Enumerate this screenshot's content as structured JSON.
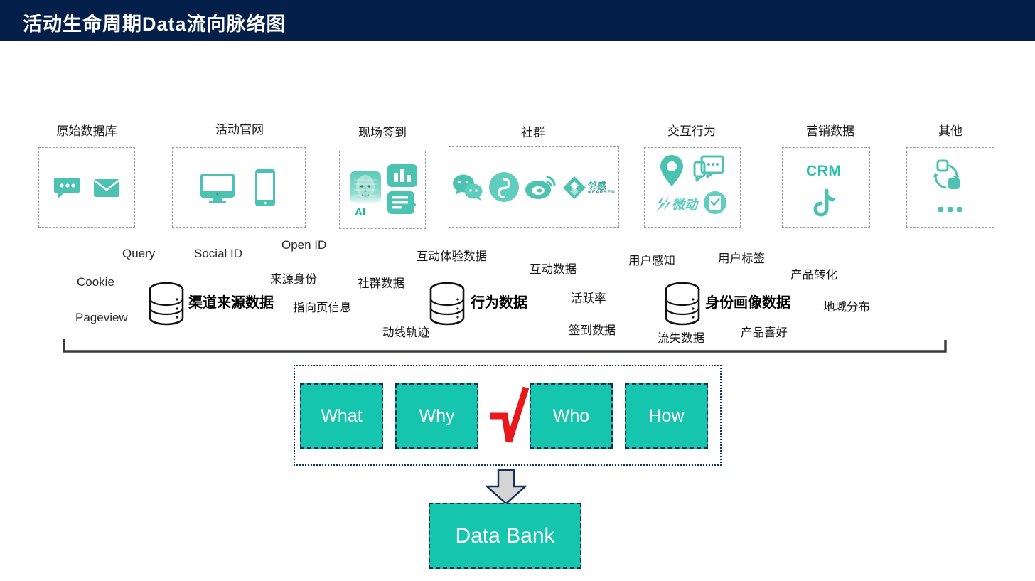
{
  "header": {
    "title": "活动生命周期Data流向脉络图",
    "bg": "#041f49"
  },
  "colors": {
    "teal": "#16c5ad",
    "icon_teal": "#4cc3b0",
    "navy": "#0f2f55",
    "red": "#e8181c",
    "gray_dash": "#9a9a9a"
  },
  "sources": [
    {
      "label": "原始数据库",
      "icons": [
        "chat-bubble-icon",
        "envelope-icon"
      ]
    },
    {
      "label": "活动官网",
      "icons": [
        "monitor-icon",
        "smartphone-icon"
      ]
    },
    {
      "label": "现场签到",
      "icons": [
        "ai-face-icon",
        "bar-chart-icon",
        "checklist-doc-icon"
      ],
      "icon_caption": "AI"
    },
    {
      "label": "社群",
      "icons": [
        "wechat-icon",
        "douyin-icon",
        "weibo-icon",
        "nearsen-icon"
      ],
      "brand_text": "邻感",
      "brand_sub": "NEARSEN"
    },
    {
      "label": "交互行为",
      "icons": [
        "location-pin-icon",
        "chat-box-icon",
        "weidong-brand-icon",
        "doc-check-circle-icon"
      ],
      "brand_text": "微动"
    },
    {
      "label": "营销数据",
      "icons": [
        "douyin-note-icon"
      ],
      "text": "CRM"
    },
    {
      "label": "其他",
      "icons": [
        "sync-arrows-icon",
        "ellipsis-icon"
      ]
    }
  ],
  "clusters": [
    {
      "title": "渠道来源数据",
      "tags": [
        "Cookie",
        "Query",
        "Pageview",
        "Social ID",
        "Open ID",
        "来源身份",
        "指向页信息"
      ]
    },
    {
      "title": "行为数据",
      "tags": [
        "社群数据",
        "互动体验数据",
        "动线轨迹",
        "互动数据",
        "活跃率",
        "签到数据"
      ]
    },
    {
      "title": "身份画像数据",
      "tags": [
        "用户感知",
        "用户标签",
        "产品转化",
        "地域分布",
        "流失数据",
        "产品喜好"
      ]
    }
  ],
  "tags_flat": {
    "cookie": "Cookie",
    "query": "Query",
    "pageview": "Pageview",
    "social_id": "Social ID",
    "open_id": "Open ID",
    "source_identity": "来源身份",
    "landing_page": "指向页信息",
    "community_data": "社群数据",
    "interactive_experience": "互动体验数据",
    "movement_track": "动线轨迹",
    "interaction_data": "互动数据",
    "active_rate": "活跃率",
    "checkin_data": "签到数据",
    "user_perception": "用户感知",
    "user_tags": "用户标签",
    "product_conversion": "产品转化",
    "region_distribution": "地域分布",
    "churn_data": "流失数据",
    "product_preference": "产品喜好"
  },
  "w_boxes": [
    {
      "label": "What"
    },
    {
      "label": "Why"
    },
    {
      "label": "Who"
    },
    {
      "label": "How"
    }
  ],
  "checkmark": {
    "name": "red-check-mark",
    "color": "#e8181c"
  },
  "output": {
    "label": "Data Bank"
  }
}
